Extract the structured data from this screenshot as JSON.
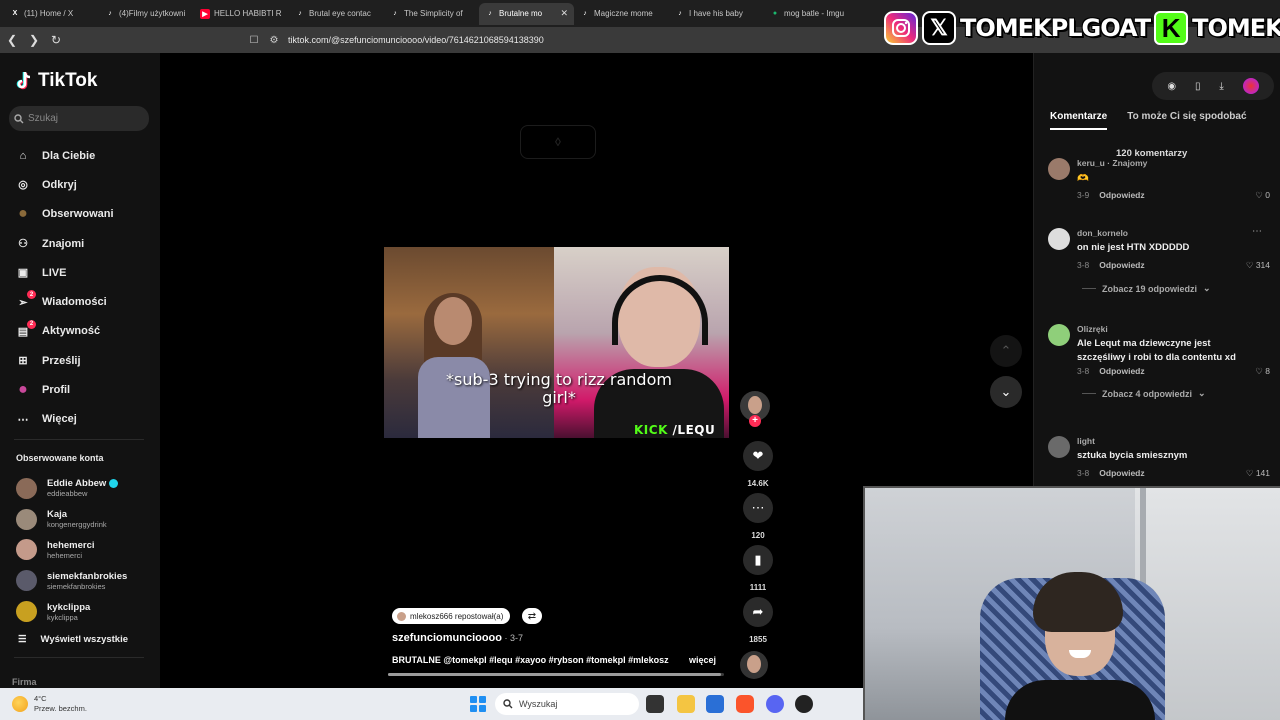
{
  "browser": {
    "tabs": [
      {
        "label": "(11) Home / X",
        "icon": "x-icon",
        "color": "#ffffff"
      },
      {
        "label": "(4)Filmy użytkowni",
        "icon": "tiktok-icon",
        "color": "#ffffff"
      },
      {
        "label": "HELLO HABIBTI R",
        "icon": "youtube-icon",
        "color": "#ff0033"
      },
      {
        "label": "Brutal eye contac",
        "icon": "tiktok-icon",
        "color": "#ffffff"
      },
      {
        "label": "The Simplicity of",
        "icon": "tiktok-icon",
        "color": "#ffffff"
      },
      {
        "label": "Brutalne mo",
        "icon": "tiktok-icon",
        "color": "#ffffff",
        "active": true
      },
      {
        "label": "Magiczne mome",
        "icon": "tiktok-icon",
        "color": "#ffffff"
      },
      {
        "label": "I have his baby",
        "icon": "tiktok-icon",
        "color": "#ffffff"
      },
      {
        "label": "mog batle - Imgu",
        "icon": "imgur-icon",
        "color": "#1bb76e"
      }
    ],
    "url": "tiktok.com/@szefunciomuncioooo/video/7614621068594138390"
  },
  "overlay": {
    "handle_1": "TOMEKPLGOAT",
    "handle_2": "TOMEKPL"
  },
  "sidebar": {
    "logo": "TikTok",
    "search_placeholder": "Szukaj",
    "nav": [
      {
        "label": "Dla Ciebie",
        "icon": "home-icon"
      },
      {
        "label": "Odkryj",
        "icon": "compass-icon"
      },
      {
        "label": "Obserwowani",
        "icon": "following-avatar-icon"
      },
      {
        "label": "Znajomi",
        "icon": "friends-icon"
      },
      {
        "label": "LIVE",
        "icon": "live-icon"
      },
      {
        "label": "Wiadomości",
        "icon": "messages-icon",
        "badge": "2"
      },
      {
        "label": "Aktywność",
        "icon": "activity-icon",
        "badge": "2"
      },
      {
        "label": "Prześlij",
        "icon": "upload-icon"
      },
      {
        "label": "Profil",
        "icon": "profile-icon"
      },
      {
        "label": "Więcej",
        "icon": "more-icon"
      }
    ],
    "followed_title": "Obserwowane konta",
    "followed": [
      {
        "name": "Eddie Abbew",
        "handle": "eddieabbew",
        "verified": true,
        "color": "#8a6a58"
      },
      {
        "name": "Kaja",
        "handle": "kongenerggydrink",
        "verified": false,
        "color": "#9a8a7a"
      },
      {
        "name": "hehemerci",
        "handle": "hehemerci",
        "verified": false,
        "color": "#c49a8a"
      },
      {
        "name": "siemekfanbrokies",
        "handle": "siemekfanbrokies",
        "verified": false,
        "color": "#5a5a6a"
      },
      {
        "name": "kykclippa",
        "handle": "kykclippa",
        "verified": false,
        "color": "#c8a020"
      }
    ],
    "see_all": "Wyświetl wszystkie",
    "footer": "Firma"
  },
  "video": {
    "caption": "*sub-3 trying to rizz random girl*",
    "kick_tag_k": "KICK",
    "kick_tag_rest": " /LEQU",
    "likes": "14.6K",
    "comments": "120",
    "saves": "1111",
    "shares": "1855",
    "repost_label": "mlekosz666 repostował(a)",
    "author": "szefunciomuncioooo",
    "date": " · 3-7",
    "description": "BRUTALNE @tomekpl #lequ #xayoo #rybson #tomekpl #mlekosz",
    "more_label": "więcej",
    "progress": 0.99
  },
  "comments_panel": {
    "tabs": [
      "Komentarze",
      "To może Ci się spodobać"
    ],
    "count_label": "120 komentarzy",
    "reply_label": "Odpowiedz",
    "comments": [
      {
        "user": "keru_u · Znajomy",
        "text": "🫶",
        "date": "3-9",
        "likes": "0",
        "avatar": "#9a7a6a"
      },
      {
        "user": "don_kornelo",
        "text": "on nie jest HTN XDDDDD",
        "date": "3-8",
        "likes": "314",
        "avatar": "#ddd",
        "view_replies": "Zobacz 19 odpowiedzi"
      },
      {
        "user": "Olizręki",
        "text": "Ale Lequt ma dziewczyne jest szczęśliwy i robi to dla contentu xd",
        "date": "3-8",
        "likes": "8",
        "avatar": "#8fcf7a",
        "view_replies": "Zobacz 4 odpowiedzi"
      },
      {
        "user": "light",
        "text": "sztuka bycia smiesznym",
        "date": "3-8",
        "likes": "141",
        "avatar": "#6a6a6a"
      }
    ]
  },
  "taskbar": {
    "temp": "4°C",
    "weather": "Przew. bezchm.",
    "search_placeholder": "Wyszukaj"
  }
}
